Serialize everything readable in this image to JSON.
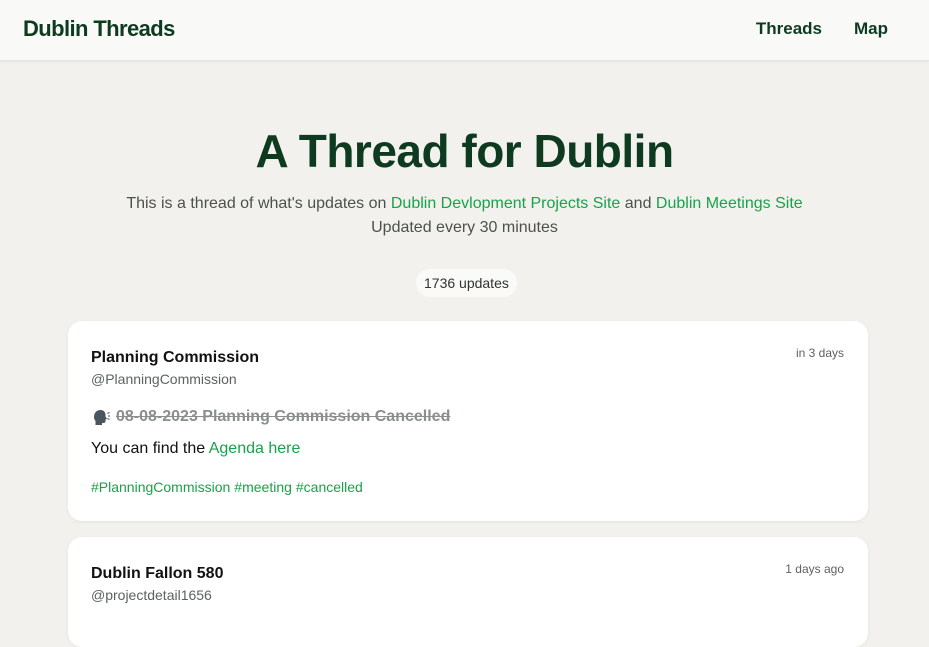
{
  "navbar": {
    "brand": "Dublin Threads",
    "links": [
      "Threads",
      "Map"
    ]
  },
  "hero": {
    "title": "A Thread for Dublin",
    "desc_prefix": "This is a thread of what's updates on",
    "link_projects": "Dublin Devlopment Projects Site",
    "desc_and": "and",
    "link_meetings": "Dublin Meetings Site",
    "update_freq": "Updated every 30 minutes"
  },
  "count": "1736 updates",
  "posts": [
    {
      "author": "Planning Commission",
      "handle": "@PlanningCommission",
      "time": "in 3 days",
      "icon": "speaking-head-icon",
      "title": "08-08-2023 Planning Commission Cancelled",
      "body_prefix": "You can find the",
      "body_link": "Agenda here",
      "tags": [
        "#PlanningCommission",
        "#meeting",
        "#cancelled"
      ]
    },
    {
      "author": "Dublin Fallon 580",
      "handle": "@projectdetail1656",
      "time": "1 days ago"
    }
  ],
  "colors": {
    "brand": "#0e3a1f",
    "link": "#17a34a",
    "background": "#f2f1ee"
  }
}
